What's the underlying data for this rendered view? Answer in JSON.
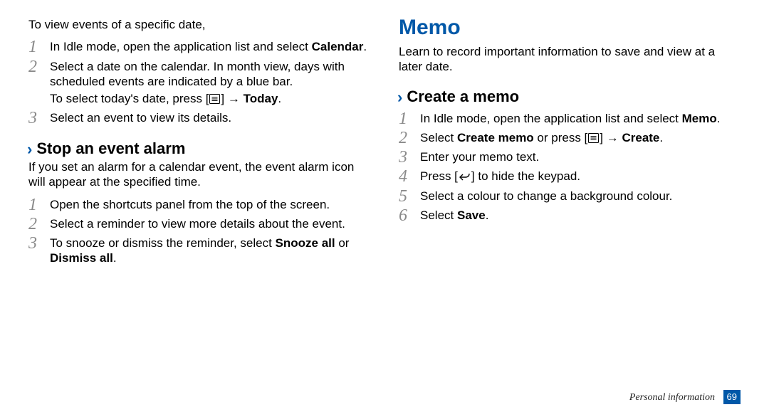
{
  "left": {
    "intro": "To view events of a specific date,",
    "viewSteps": [
      {
        "n": "1",
        "lines": [
          "In Idle mode, open the application list and select <b>Calendar</b>."
        ]
      },
      {
        "n": "2",
        "lines": [
          "Select a date on the calendar. In month view, days with scheduled events are indicated by a blue bar.",
          "To select today's date, press [__MENU__] → <b>Today</b>."
        ]
      },
      {
        "n": "3",
        "lines": [
          "Select an event to view its details."
        ]
      }
    ],
    "stopHeading": "Stop an event alarm",
    "stopDesc": "If you set an alarm for a calendar event, the event alarm icon will appear at the specified time.",
    "stopSteps": [
      {
        "n": "1",
        "lines": [
          "Open the shortcuts panel from the top of the screen."
        ]
      },
      {
        "n": "2",
        "lines": [
          "Select a reminder to view more details about the event."
        ]
      },
      {
        "n": "3",
        "lines": [
          "To snooze or dismiss the reminder, select <b>Snooze all</b> or <b>Dismiss all</b>."
        ]
      }
    ]
  },
  "right": {
    "title": "Memo",
    "titleDesc": "Learn to record important information to save and view at a later date.",
    "createHeading": "Create a memo",
    "createSteps": [
      {
        "n": "1",
        "lines": [
          "In Idle mode, open the application list and select <b>Memo</b>."
        ]
      },
      {
        "n": "2",
        "lines": [
          "Select <b>Create memo</b> or press [__MENU__] → <b>Create</b>."
        ]
      },
      {
        "n": "3",
        "lines": [
          "Enter your memo text."
        ]
      },
      {
        "n": "4",
        "lines": [
          "Press [__BACK__] to hide the keypad."
        ]
      },
      {
        "n": "5",
        "lines": [
          "Select a colour to change a background colour."
        ]
      },
      {
        "n": "6",
        "lines": [
          "Select <b>Save</b>."
        ]
      }
    ]
  },
  "footer": {
    "section": "Personal information",
    "page": "69"
  },
  "icons": {
    "menu": "<svg width='15' height='14' viewBox='0 0 15 14'><rect x='0.5' y='0.5' width='14' height='13' rx='1' fill='none' stroke='#000'/><line x1='3.5' y1='4.5' x2='11.5' y2='4.5' stroke='#000'/><line x1='3.5' y1='7'   x2='11.5' y2='7'   stroke='#000'/><line x1='3.5' y1='9.5' x2='11.5' y2='9.5' stroke='#000'/></svg>",
    "back": "<svg width='17' height='14' viewBox='0 0 17 14'><path d='M6 4 L2 8 L6 12' fill='none' stroke='#000' stroke-width='1.4'/><path d='M3 8 H10 C13 8 15 6 15 3' fill='none' stroke='#000' stroke-width='1.4'/></svg>"
  }
}
